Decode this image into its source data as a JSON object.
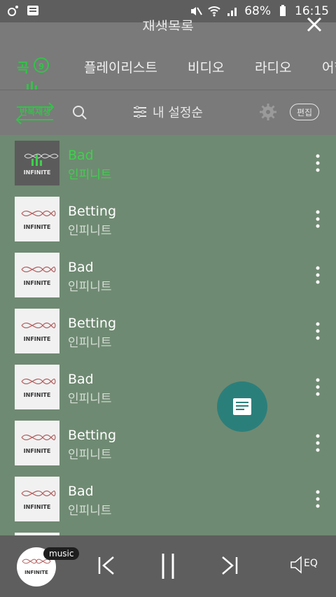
{
  "statusbar": {
    "battery": "68%",
    "time": "16:15"
  },
  "header": {
    "title": "재생목록"
  },
  "tabs": [
    {
      "label": "곡",
      "count": "9"
    },
    {
      "label": "플레이리스트"
    },
    {
      "label": "비디오"
    },
    {
      "label": "라디오"
    },
    {
      "label": "어학"
    }
  ],
  "toolbar": {
    "repeat_label": "반복재생",
    "sort_label": "내 설정순",
    "edit_label": "편집"
  },
  "playlist": [
    {
      "title": "Bad",
      "artist": "인피니트"
    },
    {
      "title": "Betting",
      "artist": "인피니트"
    },
    {
      "title": "Bad",
      "artist": "인피니트"
    },
    {
      "title": "Betting",
      "artist": "인피니트"
    },
    {
      "title": "Bad",
      "artist": "인피니트"
    },
    {
      "title": "Betting",
      "artist": "인피니트"
    },
    {
      "title": "Bad",
      "artist": "인피니트"
    }
  ],
  "album_art_text": "INFINITE",
  "player": {
    "badge": "music",
    "eq_label": "EQ"
  },
  "colors": {
    "accent": "#35c14a",
    "list_bg": "#6f8a72",
    "topbar": "#7a7a7a",
    "fab": "#2b7f7b"
  },
  "icons": [
    "menu-icon",
    "search-icon",
    "filter-icon",
    "gear-icon",
    "more-vertical-icon",
    "note-icon",
    "prev-icon",
    "pause-icon",
    "next-icon",
    "eq-icon",
    "close-icon"
  ]
}
